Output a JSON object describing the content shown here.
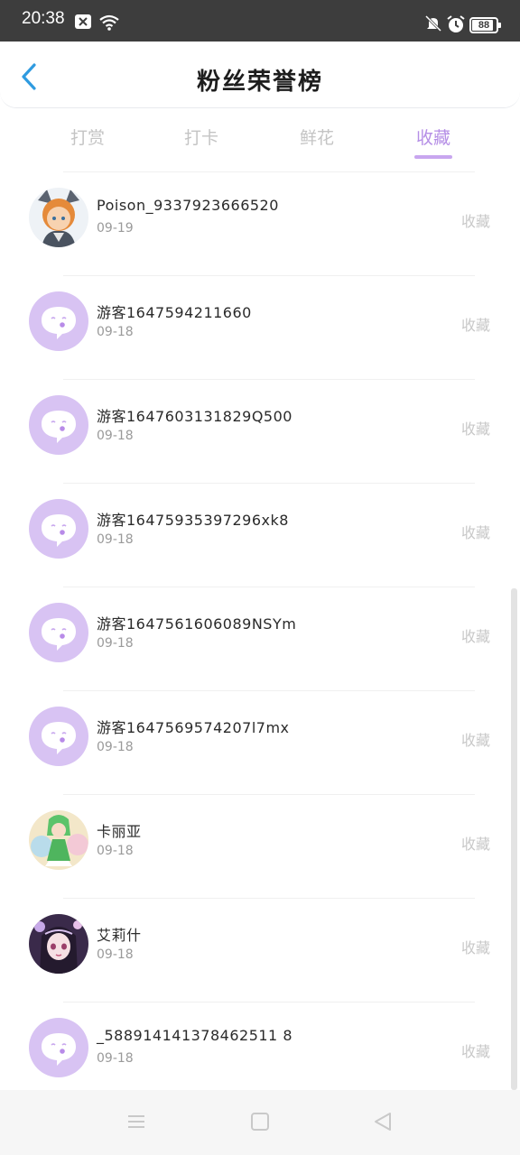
{
  "status_bar": {
    "time": "20:38",
    "battery": "88",
    "battery_level": 0.88
  },
  "header": {
    "title": "粉丝荣誉榜"
  },
  "tabs": [
    {
      "label": "打赏",
      "active": false
    },
    {
      "label": "打卡",
      "active": false
    },
    {
      "label": "鲜花",
      "active": false
    },
    {
      "label": "收藏",
      "active": true
    }
  ],
  "list": [
    {
      "name": "Poison_9337923666520",
      "date": "09-19",
      "tag": "收藏",
      "avatar": "anime-fox-avatar"
    },
    {
      "name": "游客1647594211660",
      "date": "09-18",
      "tag": "收藏",
      "avatar": "default-chat-avatar"
    },
    {
      "name": "游客1647603131829Q500",
      "date": "09-18",
      "tag": "收藏",
      "avatar": "default-chat-avatar"
    },
    {
      "name": "游客16475935397296xk8",
      "date": "09-18",
      "tag": "收藏",
      "avatar": "default-chat-avatar"
    },
    {
      "name": "游客1647561606089NSYm",
      "date": "09-18",
      "tag": "收藏",
      "avatar": "default-chat-avatar"
    },
    {
      "name": "游客1647569574207l7mx",
      "date": "09-18",
      "tag": "收藏",
      "avatar": "default-chat-avatar"
    },
    {
      "name": "卡丽亚",
      "date": "09-18",
      "tag": "收藏",
      "avatar": "anime-green-girl-avatar"
    },
    {
      "name": "艾莉什",
      "date": "09-18",
      "tag": "收藏",
      "avatar": "anime-dark-hair-girl-avatar"
    },
    {
      "name": "_588914141378462511 8",
      "date": "09-18",
      "tag": "收藏",
      "avatar": "default-chat-avatar"
    }
  ],
  "colors": {
    "accent": "#b58ee6",
    "avatar_default": "#d8c3f3",
    "back_arrow": "#2f9be0"
  }
}
